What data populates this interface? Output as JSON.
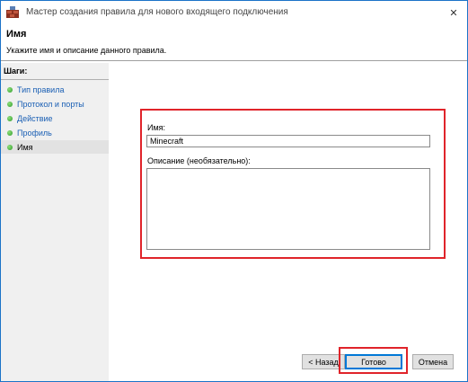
{
  "window": {
    "title": "Мастер создания правила для нового входящего подключения",
    "controls": {
      "close": "✕"
    }
  },
  "header": {
    "title": "Имя",
    "subtitle": "Укажите имя и описание данного правила."
  },
  "sidebar": {
    "title": "Шаги:",
    "items": [
      {
        "label": "Тип правила"
      },
      {
        "label": "Протокол и порты"
      },
      {
        "label": "Действие"
      },
      {
        "label": "Профиль"
      },
      {
        "label": "Имя"
      }
    ]
  },
  "form": {
    "name_label": "Имя:",
    "name_value": "Minecraft",
    "description_label": "Описание (необязательно):",
    "description_value": ""
  },
  "buttons": {
    "back": "< Назад",
    "finish": "Готово",
    "cancel": "Отмена"
  },
  "colors": {
    "highlight": "#e0242a",
    "link": "#1a5fb4",
    "window_border": "#1c73c8"
  }
}
